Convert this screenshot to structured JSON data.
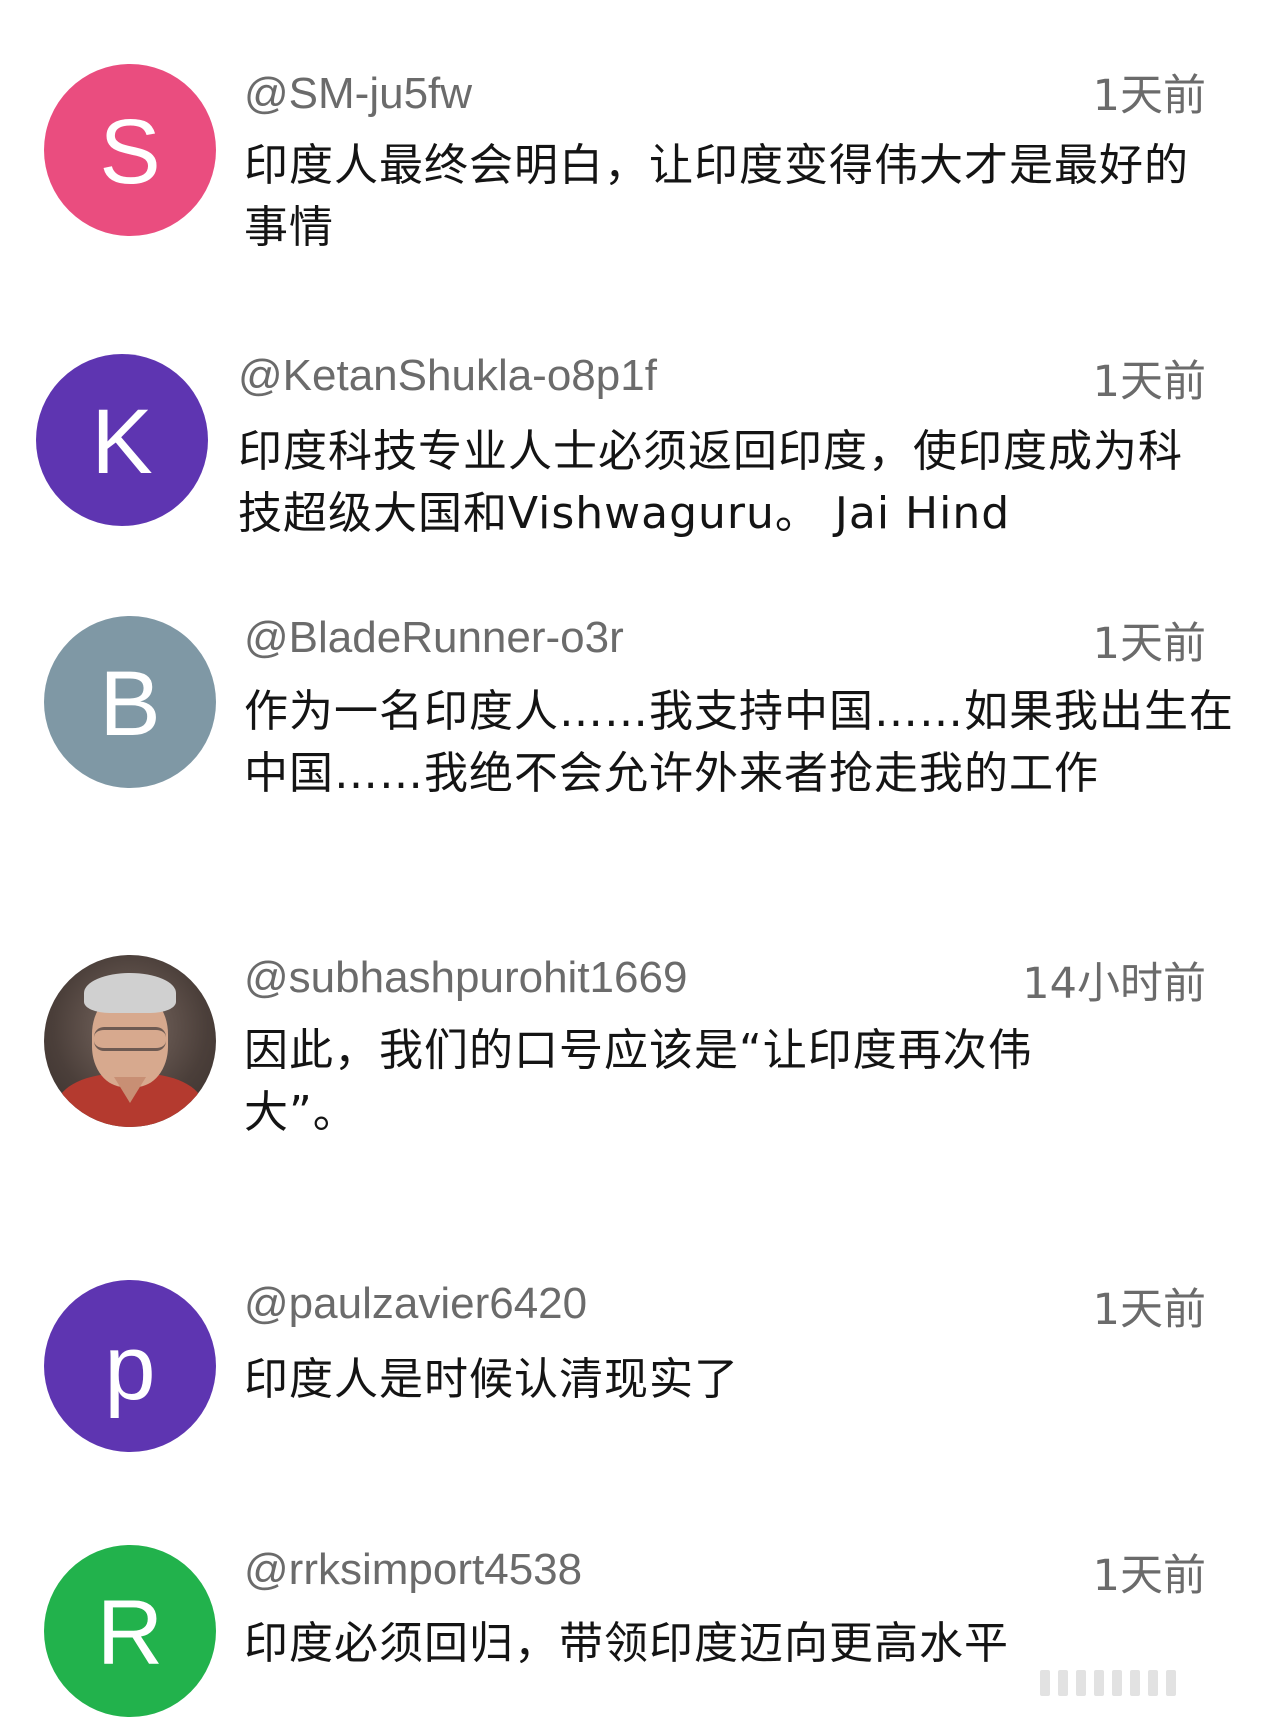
{
  "comments": [
    {
      "handle": "@SM-ju5fw",
      "time": "1天前",
      "text": "印度人最终会明白，让印度变得伟大才是最好的事情",
      "avatar": {
        "letter": "S",
        "color": "#ea4d7f"
      }
    },
    {
      "handle": "@KetanShukla-o8p1f",
      "time": "1天前",
      "text": "印度科技专业人士必须返回印度，使印度成为科技超级大国和Vishwaguru。 Jai Hind",
      "avatar": {
        "letter": "K",
        "color": "#5e35b1"
      }
    },
    {
      "handle": "@BladeRunner-o3r",
      "time": "1天前",
      "text": "作为一名印度人……我支持中国……如果我出生在中国……我绝不会允许外来者抢走我的工作",
      "avatar": {
        "letter": "B",
        "color": "#7f98a5"
      }
    },
    {
      "handle": "@subhashpurohit1669",
      "time": "14小时前",
      "text": "因此，我们的口号应该是“让印度再次伟大”。",
      "avatar": {
        "type": "photo"
      }
    },
    {
      "handle": "@paulzavier6420",
      "time": "1天前",
      "text": "印度人是时候认清现实了",
      "avatar": {
        "letter": "p",
        "color": "#5e35b1"
      }
    },
    {
      "handle": "@rrksimport4538",
      "time": "1天前",
      "text": "印度必须回归，带领印度迈向更高水平",
      "avatar": {
        "letter": "R",
        "color": "#22b24c"
      }
    }
  ],
  "icons": {
    "photo_avatar": "person-photo-icon"
  }
}
